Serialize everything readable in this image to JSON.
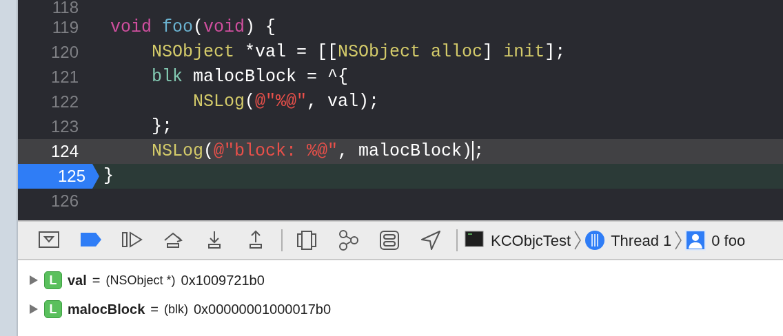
{
  "editor": {
    "lines": [
      {
        "number": "118",
        "current_line": false,
        "program_counter": false
      },
      {
        "number": "119",
        "current_line": false,
        "program_counter": false,
        "tokens": [
          {
            "kind": "keyword",
            "text": "void"
          },
          {
            "kind": "function",
            "text": " foo"
          },
          {
            "kind": "plain",
            "text": "("
          },
          {
            "kind": "keyword",
            "text": "void"
          },
          {
            "kind": "plain",
            "text": ") {"
          }
        ]
      },
      {
        "number": "120",
        "current_line": false,
        "program_counter": false,
        "tokens": [
          {
            "kind": "class",
            "text": "    NSObject"
          },
          {
            "kind": "plain",
            "text": " *val = [["
          },
          {
            "kind": "class",
            "text": "NSObject alloc"
          },
          {
            "kind": "plain",
            "text": "] "
          },
          {
            "kind": "class",
            "text": "init"
          },
          {
            "kind": "plain",
            "text": "];"
          }
        ]
      },
      {
        "number": "121",
        "current_line": false,
        "program_counter": false,
        "tokens": [
          {
            "kind": "type",
            "text": "    blk"
          },
          {
            "kind": "plain",
            "text": " malocBlock = ^{"
          }
        ]
      },
      {
        "number": "122",
        "current_line": false,
        "program_counter": false,
        "tokens": [
          {
            "kind": "class",
            "text": "        NSLog"
          },
          {
            "kind": "plain",
            "text": "("
          },
          {
            "kind": "string",
            "text": "@\"%@\""
          },
          {
            "kind": "plain",
            "text": ", val);"
          }
        ]
      },
      {
        "number": "123",
        "current_line": false,
        "program_counter": false,
        "tokens": [
          {
            "kind": "plain",
            "text": "    };"
          }
        ]
      },
      {
        "number": "124",
        "current_line": true,
        "program_counter": false,
        "tokens": [
          {
            "kind": "class",
            "text": "    NSLog"
          },
          {
            "kind": "plain",
            "text": "("
          },
          {
            "kind": "string",
            "text": "@\"block: %@\""
          },
          {
            "kind": "plain",
            "text": ", malocBlock)",
            "caret_after": true
          },
          {
            "kind": "plain",
            "text": ";"
          }
        ]
      },
      {
        "number": "125",
        "current_line": false,
        "program_counter": true,
        "tokens": [
          {
            "kind": "plain",
            "text": "}"
          }
        ]
      },
      {
        "number": "126",
        "current_line": false,
        "program_counter": false
      }
    ]
  },
  "debug_bar": {
    "buttons": [
      {
        "kind": "hide-console",
        "on": false
      },
      {
        "kind": "breakpoints",
        "on": true
      },
      {
        "kind": "continue",
        "on": false
      },
      {
        "kind": "step-over",
        "on": false
      },
      {
        "kind": "step-into",
        "on": false
      },
      {
        "kind": "step-out",
        "on": false
      },
      {
        "kind": "separator"
      },
      {
        "kind": "view-debugger",
        "on": false
      },
      {
        "kind": "memory-graph",
        "on": false
      },
      {
        "kind": "environment",
        "on": false
      },
      {
        "kind": "location",
        "on": false
      },
      {
        "kind": "separator"
      }
    ],
    "breadcrumbs": [
      {
        "kind": "app",
        "label": "KCObjcTest"
      },
      {
        "kind": "thread",
        "label": "Thread 1"
      },
      {
        "kind": "frame",
        "label": "0 foo"
      }
    ]
  },
  "variables": [
    {
      "expanded": false,
      "badge": "L",
      "name": "val",
      "operator": "=",
      "type": "(NSObject *)",
      "value": "0x1009721b0"
    },
    {
      "expanded": false,
      "badge": "L",
      "name": "malocBlock",
      "operator": "=",
      "type": "(blk)",
      "value": "0x00000001000017b0"
    }
  ]
}
